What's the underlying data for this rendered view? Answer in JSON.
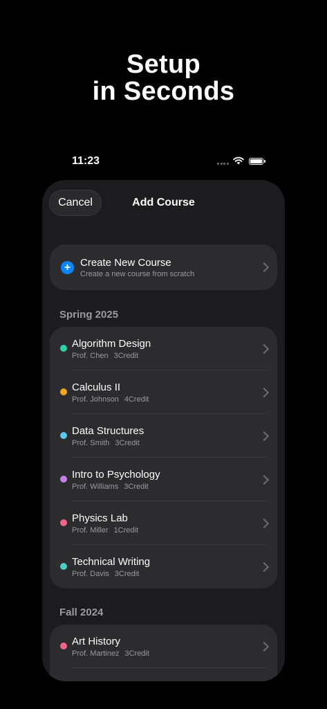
{
  "headline": {
    "line1": "Setup",
    "line2": "in Seconds"
  },
  "status_bar": {
    "time": "11:23"
  },
  "sheet": {
    "cancel_label": "Cancel",
    "title": "Add Course",
    "create": {
      "title": "Create New Course",
      "subtitle": "Create a new course from scratch"
    },
    "sections": [
      {
        "label": "Spring 2025",
        "courses": [
          {
            "name": "Algorithm Design",
            "professor": "Prof. Chen",
            "credit": "3Credit",
            "color": "#30d1a8"
          },
          {
            "name": "Calculus II",
            "professor": "Prof. Johnson",
            "credit": "4Credit",
            "color": "#f5a623"
          },
          {
            "name": "Data Structures",
            "professor": "Prof. Smith",
            "credit": "3Credit",
            "color": "#5ac8ea"
          },
          {
            "name": "Intro to Psychology",
            "professor": "Prof. Williams",
            "credit": "3Credit",
            "color": "#c77dea"
          },
          {
            "name": "Physics Lab",
            "professor": "Prof. Miller",
            "credit": "1Credit",
            "color": "#f0648c"
          },
          {
            "name": "Technical Writing",
            "professor": "Prof. Davis",
            "credit": "3Credit",
            "color": "#4ecdc4"
          }
        ]
      },
      {
        "label": "Fall 2024",
        "courses": [
          {
            "name": "Art History",
            "professor": "Prof. Martinez",
            "credit": "3Credit",
            "color": "#f0648c"
          }
        ]
      }
    ]
  },
  "icons": {
    "signal": "cellular-signal-icon",
    "wifi": "wifi-icon",
    "battery": "battery-icon",
    "plus": "plus-circle-icon",
    "chevron": "chevron-right-icon"
  }
}
